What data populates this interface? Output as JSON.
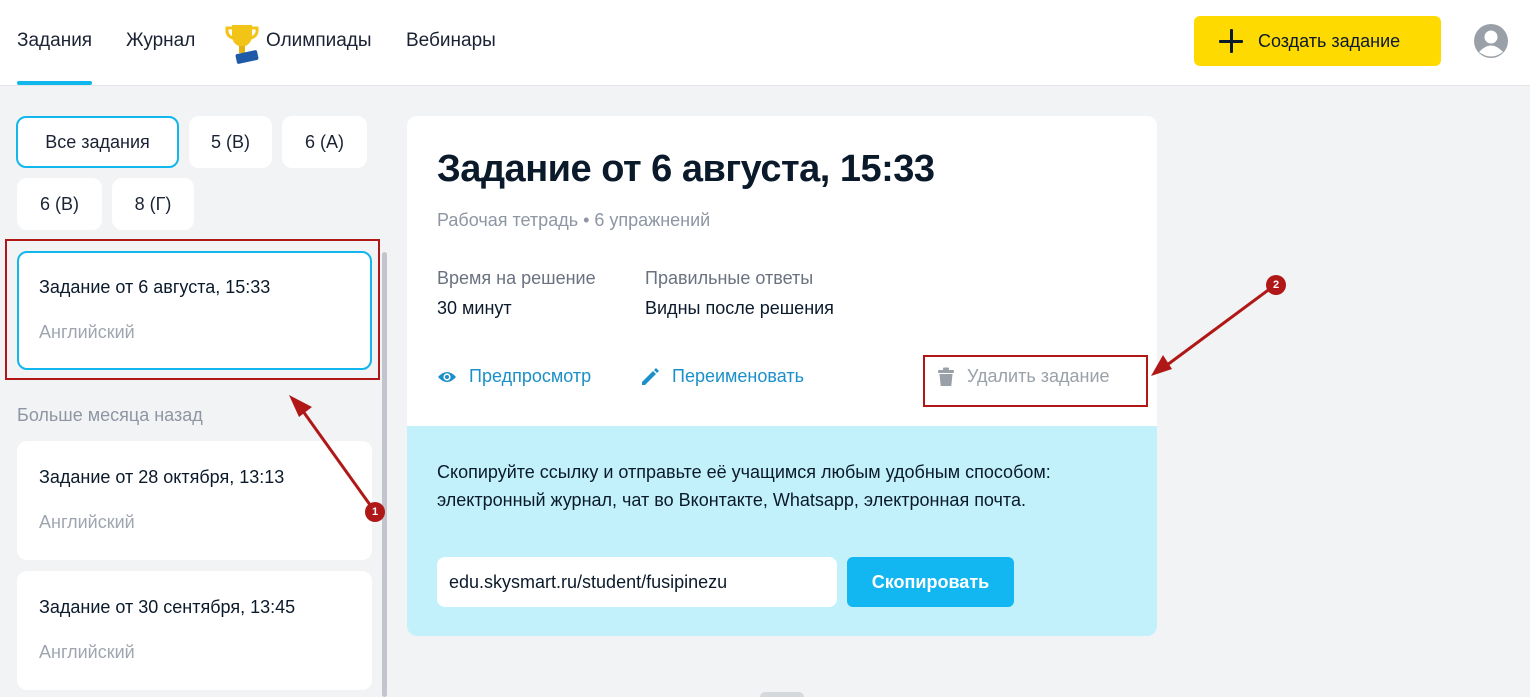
{
  "nav": {
    "tabs": [
      {
        "label": "Задания",
        "active": true
      },
      {
        "label": "Журнал"
      },
      {
        "label": "Олимпиады",
        "icon": "trophy-icon"
      },
      {
        "label": "Вебинары"
      }
    ],
    "create_button": "Создать задание"
  },
  "filters": [
    "Все задания",
    "5 (В)",
    "6 (А)",
    "6 (В)",
    "8 (Г)"
  ],
  "tasks": [
    {
      "title": "Задание от 6 августа, 15:33",
      "subject": "Английский",
      "selected": true
    },
    {
      "title": "Задание от 28 октября, 13:13",
      "subject": "Английский"
    },
    {
      "title": "Задание от 30 сентября, 13:45",
      "subject": "Английский"
    }
  ],
  "section_label": "Больше месяца назад",
  "detail": {
    "title": "Задание от 6 августа, 15:33",
    "meta": "Рабочая тетрадь • 6 упражнений",
    "time_label": "Время на решение",
    "time_value": "30 минут",
    "answers_label": "Правильные ответы",
    "answers_value": "Видны после решения",
    "actions": {
      "preview": "Предпросмотр",
      "rename": "Переименовать",
      "delete": "Удалить задание"
    },
    "share": {
      "text": "Скопируйте ссылку и отправьте её учащимся любым удобным способом: электронный журнал, чат во Вконтакте, Whatsapp, электронная почта.",
      "link": "edu.skysmart.ru/student/fusipinezu",
      "copy_button": "Скопировать"
    }
  },
  "annotations": {
    "badge1": "1",
    "badge2": "2"
  },
  "colors": {
    "accent": "#10b6ec",
    "link": "#1b8fc9",
    "cta": "#ffda00",
    "share_bg": "#c2f1fb",
    "annotation": "#b01818"
  }
}
